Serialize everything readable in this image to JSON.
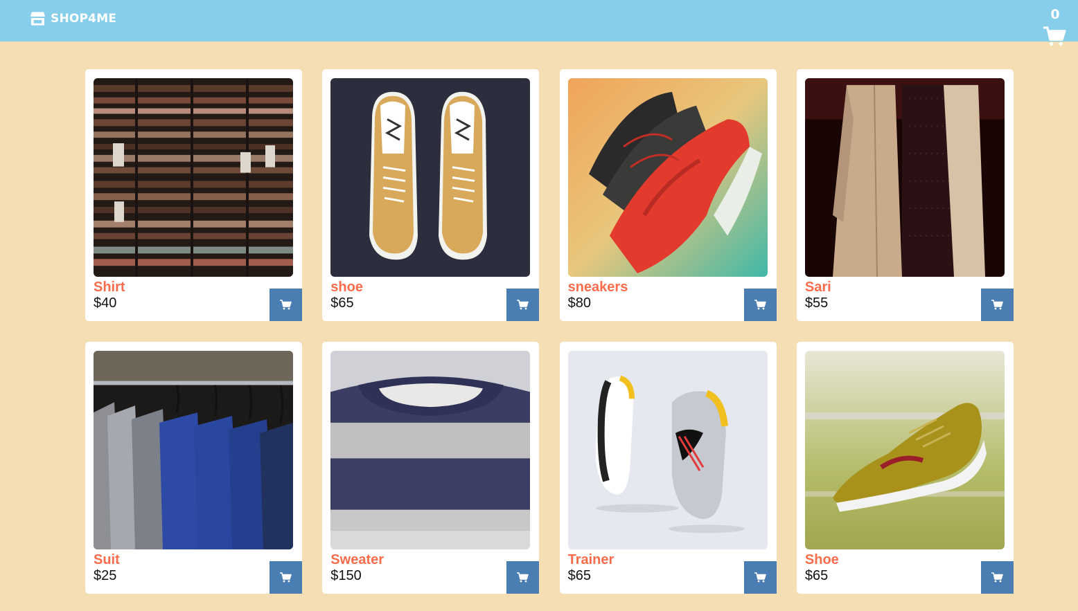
{
  "header": {
    "brand": "SHOP4ME",
    "brand_icon": "store-icon",
    "cart_count": "0",
    "cart_icon": "shopping-cart-icon"
  },
  "colors": {
    "page_background": "#f5deb3",
    "navbar": "#87ceeb",
    "product_name": "#fa6c4c",
    "add_button": "#4a7eb3"
  },
  "products": [
    {
      "name": "Shirt",
      "price": "$40",
      "image": "shirts-on-shelves-photo",
      "button_icon": "add-to-cart-icon"
    },
    {
      "name": "shoe",
      "price": "$65",
      "image": "tan-canvas-shoes-photo",
      "button_icon": "add-to-cart-icon"
    },
    {
      "name": "sneakers",
      "price": "$80",
      "image": "red-sneakers-photo",
      "button_icon": "add-to-cart-icon"
    },
    {
      "name": "Sari",
      "price": "$55",
      "image": "embroidered-garment-photo",
      "button_icon": "add-to-cart-icon"
    },
    {
      "name": "Suit",
      "price": "$25",
      "image": "suits-on-rack-photo",
      "button_icon": "add-to-cart-icon"
    },
    {
      "name": "Sweater",
      "price": "$150",
      "image": "striped-sweater-photo",
      "button_icon": "add-to-cart-icon"
    },
    {
      "name": "Trainer",
      "price": "$65",
      "image": "trainers-photo",
      "button_icon": "add-to-cart-icon"
    },
    {
      "name": "Shoe",
      "price": "$65",
      "image": "gold-sneaker-photo",
      "button_icon": "add-to-cart-icon"
    }
  ]
}
